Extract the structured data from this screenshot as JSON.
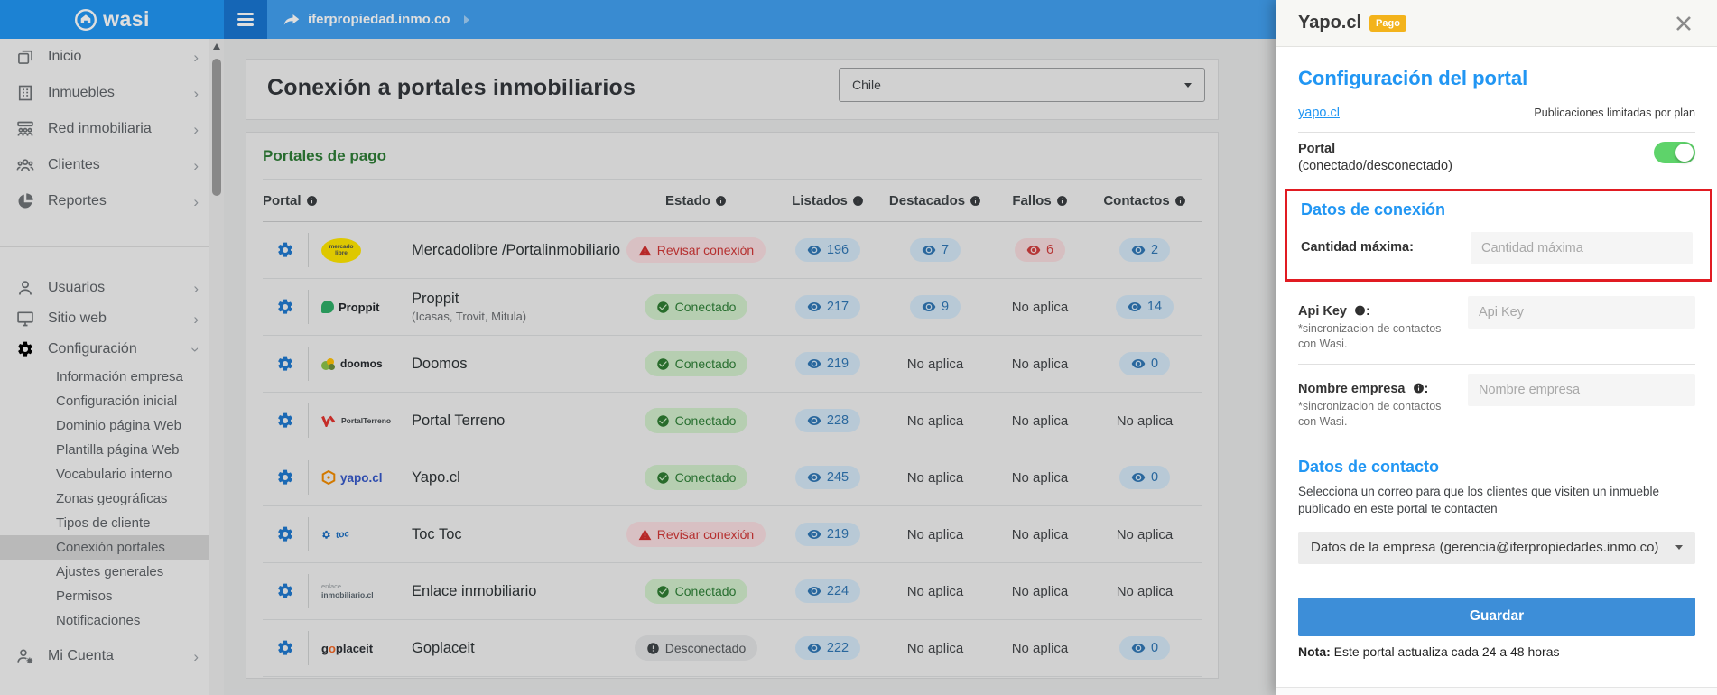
{
  "topbar": {
    "logo_text": "wasi",
    "breadcrumb": "iferpropiedad.inmo.co"
  },
  "sidebar": {
    "main_items": [
      {
        "label": "Inicio",
        "icon": "home"
      },
      {
        "label": "Inmuebles",
        "icon": "building"
      },
      {
        "label": "Red inmobiliaria",
        "icon": "network"
      },
      {
        "label": "Clientes",
        "icon": "clients"
      },
      {
        "label": "Reportes",
        "icon": "reports"
      }
    ],
    "secondary_items": [
      {
        "label": "Usuarios",
        "icon": "user",
        "chevron": "right"
      },
      {
        "label": "Sitio web",
        "icon": "monitor",
        "chevron": "right"
      },
      {
        "label": "Configuración",
        "icon": "gear",
        "chevron": "down"
      }
    ],
    "config_subitems": [
      {
        "label": "Información empresa"
      },
      {
        "label": "Configuración inicial"
      },
      {
        "label": "Dominio página Web"
      },
      {
        "label": "Plantilla página Web"
      },
      {
        "label": "Vocabulario interno"
      },
      {
        "label": "Zonas geográficas"
      },
      {
        "label": "Tipos de cliente"
      },
      {
        "label": "Conexión portales",
        "active": true
      },
      {
        "label": "Ajustes generales"
      },
      {
        "label": "Permisos"
      },
      {
        "label": "Notificaciones"
      }
    ],
    "account_item": {
      "label": "Mi Cuenta",
      "icon": "user-gear",
      "chevron": "right"
    }
  },
  "main": {
    "title": "Conexión a portales inmobiliarios",
    "country_select": "Chile",
    "section_title": "Portales de pago",
    "table": {
      "headers": [
        "Portal",
        "Estado",
        "Listados",
        "Destacados",
        "Fallos",
        "Contactos"
      ],
      "rows": [
        {
          "logo": {
            "kind": "mercadolibre",
            "text": "mercado libre"
          },
          "name": "Mercadolibre /Portalinmobiliario",
          "subtitle": "",
          "estado": {
            "label": "Revisar conexión",
            "type": "err"
          },
          "listados": {
            "type": "pill",
            "value": "196"
          },
          "destacados": {
            "type": "pill",
            "value": "7"
          },
          "fallos": {
            "type": "pill-red",
            "value": "6"
          },
          "contactos": {
            "type": "pill",
            "value": "2"
          }
        },
        {
          "logo": {
            "kind": "proppit",
            "text": "Proppit"
          },
          "name": "Proppit",
          "subtitle": "(Icasas, Trovit, Mitula)",
          "estado": {
            "label": "Conectado",
            "type": "ok"
          },
          "listados": {
            "type": "pill",
            "value": "217"
          },
          "destacados": {
            "type": "pill",
            "value": "9"
          },
          "fallos": {
            "type": "text",
            "value": "No aplica"
          },
          "contactos": {
            "type": "pill",
            "value": "14"
          }
        },
        {
          "logo": {
            "kind": "doomos",
            "text": "doomos"
          },
          "name": "Doomos",
          "subtitle": "",
          "estado": {
            "label": "Conectado",
            "type": "ok"
          },
          "listados": {
            "type": "pill",
            "value": "219"
          },
          "destacados": {
            "type": "text",
            "value": "No aplica"
          },
          "fallos": {
            "type": "text",
            "value": "No aplica"
          },
          "contactos": {
            "type": "pill",
            "value": "0"
          }
        },
        {
          "logo": {
            "kind": "portalterreno",
            "text": "PortalTerreno"
          },
          "name": "Portal Terreno",
          "subtitle": "",
          "estado": {
            "label": "Conectado",
            "type": "ok"
          },
          "listados": {
            "type": "pill",
            "value": "228"
          },
          "destacados": {
            "type": "text",
            "value": "No aplica"
          },
          "fallos": {
            "type": "text",
            "value": "No aplica"
          },
          "contactos": {
            "type": "text",
            "value": "No aplica"
          }
        },
        {
          "logo": {
            "kind": "yapo",
            "text": "yapo.cl"
          },
          "name": "Yapo.cl",
          "subtitle": "",
          "estado": {
            "label": "Conectado",
            "type": "ok"
          },
          "listados": {
            "type": "pill",
            "value": "245"
          },
          "destacados": {
            "type": "text",
            "value": "No aplica"
          },
          "fallos": {
            "type": "text",
            "value": "No aplica"
          },
          "contactos": {
            "type": "pill",
            "value": "0"
          }
        },
        {
          "logo": {
            "kind": "toctoc",
            "text": "toc"
          },
          "name": "Toc Toc",
          "subtitle": "",
          "estado": {
            "label": "Revisar conexión",
            "type": "err"
          },
          "listados": {
            "type": "pill",
            "value": "219"
          },
          "destacados": {
            "type": "text",
            "value": "No aplica"
          },
          "fallos": {
            "type": "text",
            "value": "No aplica"
          },
          "contactos": {
            "type": "text",
            "value": "No aplica"
          }
        },
        {
          "logo": {
            "kind": "enlace",
            "text": "enlace",
            "text2": "inmobiliario.cl"
          },
          "name": "Enlace inmobiliario",
          "subtitle": "",
          "estado": {
            "label": "Conectado",
            "type": "ok"
          },
          "listados": {
            "type": "pill",
            "value": "224"
          },
          "destacados": {
            "type": "text",
            "value": "No aplica"
          },
          "fallos": {
            "type": "text",
            "value": "No aplica"
          },
          "contactos": {
            "type": "text",
            "value": "No aplica"
          }
        },
        {
          "logo": {
            "kind": "goplaceit",
            "text": "goplaceit"
          },
          "name": "Goplaceit",
          "subtitle": "",
          "estado": {
            "label": "Desconectado",
            "type": "off"
          },
          "listados": {
            "type": "pill",
            "value": "222"
          },
          "destacados": {
            "type": "text",
            "value": "No aplica"
          },
          "fallos": {
            "type": "text",
            "value": "No aplica"
          },
          "contactos": {
            "type": "pill",
            "value": "0"
          }
        }
      ]
    }
  },
  "panel": {
    "title": "Yapo.cl",
    "badge": "Pago",
    "section_portal_title": "Configuración del portal",
    "link": "yapo.cl",
    "plan_note": "Publicaciones limitadas por plan",
    "portal_label": "Portal",
    "portal_sublabel": "(conectado/desconectado)",
    "connection_title": "Datos de conexión",
    "fields": [
      {
        "label": "Cantidad máxima",
        "placeholder": "Cantidad máxima",
        "has_info": false,
        "note": ""
      },
      {
        "label": "Api Key",
        "placeholder": "Api Key",
        "has_info": true,
        "note": "*sincronizacion de contactos con Wasi."
      },
      {
        "label": "Nombre empresa",
        "placeholder": "Nombre empresa",
        "has_info": true,
        "note": "*sincronizacion de contactos con Wasi."
      }
    ],
    "contact_title": "Datos de contacto",
    "contact_desc": "Selecciona un correo para que los clientes que visiten un inmueble publicado en este portal te contacten",
    "contact_select": "Datos de la empresa (gerencia@iferpropiedades.inmo.co)",
    "save_label": "Guardar",
    "note_bold": "Nota:",
    "note_text": " Este portal actualiza cada 24 a 48 horas"
  },
  "colors": {
    "accent_blue": "#2196f3",
    "topbar_blue": "#42a0f0",
    "section_green": "#2f7d36",
    "status_connected": "#2f8038",
    "status_error": "#d03737",
    "toggle_green": "#5ed36a",
    "badge_yellow": "#f3b31b",
    "annotation_red": "#e11b22",
    "save_button_blue": "#3d8ed8"
  }
}
